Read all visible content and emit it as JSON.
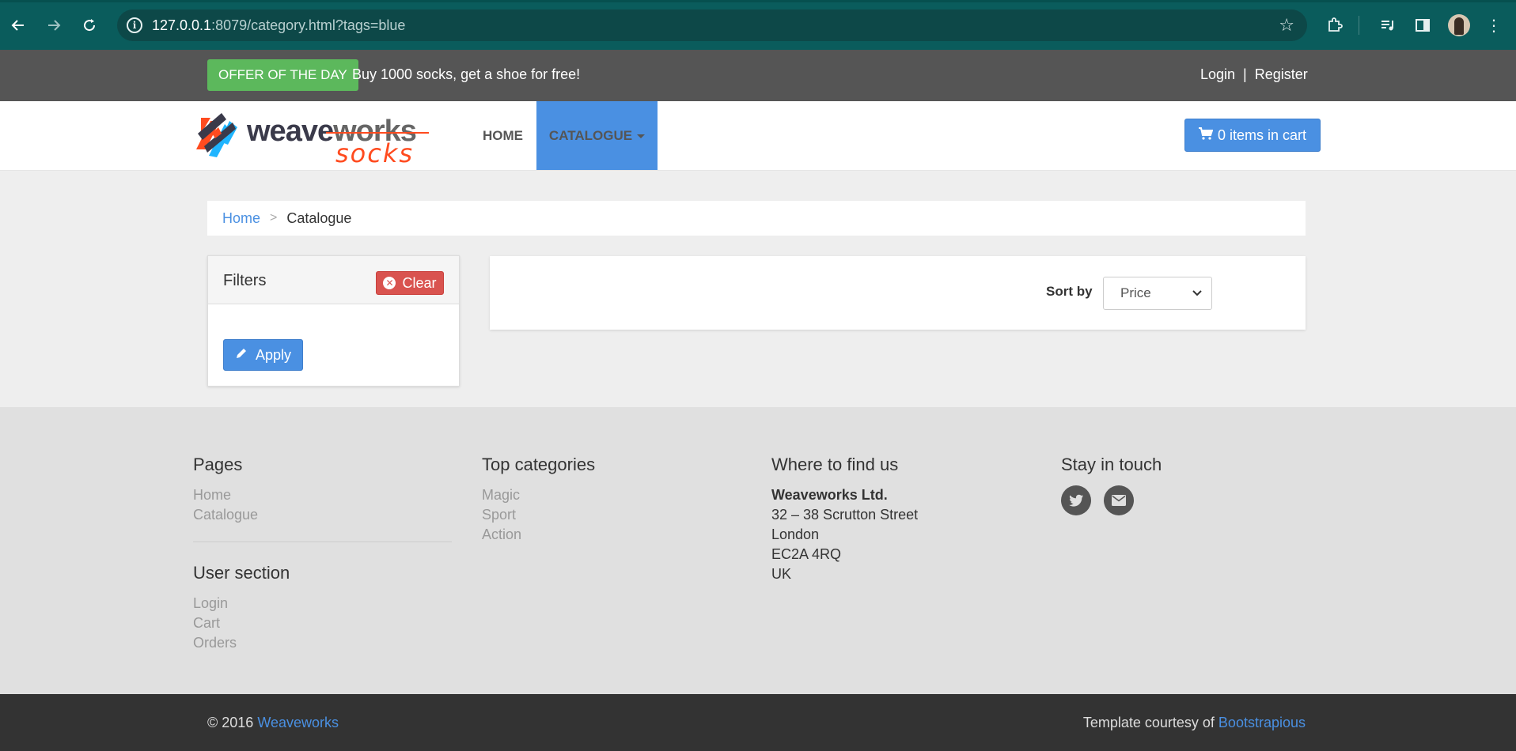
{
  "browser": {
    "url_host": "127.0.0.1",
    "url_rest": ":8079/category.html?tags=blue"
  },
  "topbar": {
    "offer_badge": "OFFER OF THE DAY",
    "offer_text": "Buy 1000 socks, get a shoe for free!",
    "login": "Login",
    "separator": "|",
    "register": "Register"
  },
  "navbar": {
    "logo_word1": "weave",
    "logo_word2": "works",
    "logo_word3": "socks",
    "home": "HOME",
    "catalogue": "CATALOGUE",
    "cart": "0 items in cart"
  },
  "breadcrumb": {
    "home": "Home",
    "separator": ">",
    "current": "Catalogue"
  },
  "filters": {
    "title": "Filters",
    "clear": "Clear",
    "apply": "Apply"
  },
  "sort": {
    "label": "Sort by",
    "selected": "Price"
  },
  "footer": {
    "pages": {
      "title": "Pages",
      "links": [
        "Home",
        "Catalogue"
      ]
    },
    "user_section": {
      "title": "User section",
      "links": [
        "Login",
        "Cart",
        "Orders"
      ]
    },
    "top_categories": {
      "title": "Top categories",
      "links": [
        "Magic",
        "Sport",
        "Action"
      ]
    },
    "where": {
      "title": "Where to find us",
      "company": "Weaveworks Ltd.",
      "lines": [
        "32 – 38 Scrutton Street",
        "London",
        "EC2A 4RQ",
        "UK"
      ]
    },
    "stay": {
      "title": "Stay in touch"
    }
  },
  "copyright": {
    "left_prefix": "© 2016",
    "left_link": "Weaveworks",
    "right_prefix": "Template courtesy of",
    "right_link": "Bootstrapious"
  },
  "colors": {
    "primary": "#4a90e2",
    "offer": "#5cb85c",
    "danger": "#d9534f",
    "topbar": "#555555",
    "chrome": "#0a5c5c"
  },
  "icons": {
    "back": "back-arrow-icon",
    "forward": "forward-arrow-icon",
    "reload": "reload-icon",
    "info": "info-icon",
    "star": "bookmark-star-icon",
    "cart": "cart-icon",
    "clear": "times-circle-icon",
    "apply": "pencil-icon",
    "twitter": "twitter-icon",
    "envelope": "envelope-icon"
  }
}
